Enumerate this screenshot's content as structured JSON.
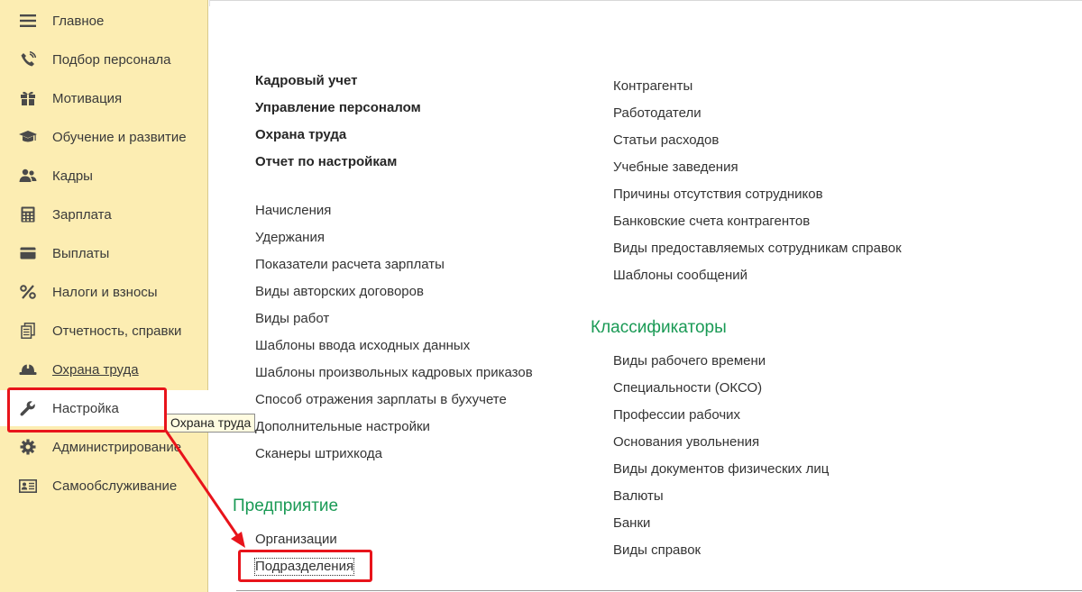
{
  "sidebar": {
    "items": [
      {
        "label": "Главное",
        "icon": "menu-lines-icon"
      },
      {
        "label": "Подбор персонала",
        "icon": "phone-icon"
      },
      {
        "label": "Мотивация",
        "icon": "gift-icon"
      },
      {
        "label": "Обучение и развитие",
        "icon": "graduation-cap-icon"
      },
      {
        "label": "Кадры",
        "icon": "people-icon"
      },
      {
        "label": "Зарплата",
        "icon": "calculator-icon"
      },
      {
        "label": "Выплаты",
        "icon": "card-icon"
      },
      {
        "label": "Налоги и взносы",
        "icon": "percent-icon"
      },
      {
        "label": "Отчетность, справки",
        "icon": "documents-icon"
      },
      {
        "label": "Охрана труда",
        "icon": "hard-hat-icon"
      },
      {
        "label": "Настройка",
        "icon": "wrench-icon"
      },
      {
        "label": "Администрирование",
        "icon": "gear-icon"
      },
      {
        "label": "Самообслуживание",
        "icon": "id-card-icon"
      }
    ]
  },
  "tooltip": "Охрана труда",
  "main": {
    "bold_links": [
      "Кадровый учет",
      "Управление персоналом",
      "Охрана труда",
      "Отчет по настройкам"
    ],
    "left_links": [
      "Начисления",
      "Удержания",
      "Показатели расчета зарплаты",
      "Виды авторских договоров",
      "Виды работ",
      "Шаблоны ввода исходных данных",
      "Шаблоны произвольных кадровых приказов",
      "Способ отражения зарплаты в бухучете",
      "Дополнительные настройки",
      "Сканеры штрихкода"
    ],
    "enterprise": {
      "title": "Предприятие",
      "links": [
        "Организации",
        "Подразделения"
      ]
    },
    "right_links": [
      "Контрагенты",
      "Работодатели",
      "Статьи расходов",
      "Учебные заведения",
      "Причины отсутствия сотрудников",
      "Банковские счета контрагентов",
      "Виды предоставляемых сотрудникам справок",
      "Шаблоны сообщений"
    ],
    "classifiers": {
      "title": "Классификаторы",
      "links": [
        "Виды рабочего времени",
        "Специальности (ОКСО)",
        "Профессии рабочих",
        "Основания увольнения",
        "Виды документов физических лиц",
        "Валюты",
        "Банки",
        "Виды справок"
      ]
    }
  },
  "colors": {
    "sidebar_bg": "#fcedb2",
    "section_title": "#1a9a55",
    "highlight": "#e8141b"
  }
}
